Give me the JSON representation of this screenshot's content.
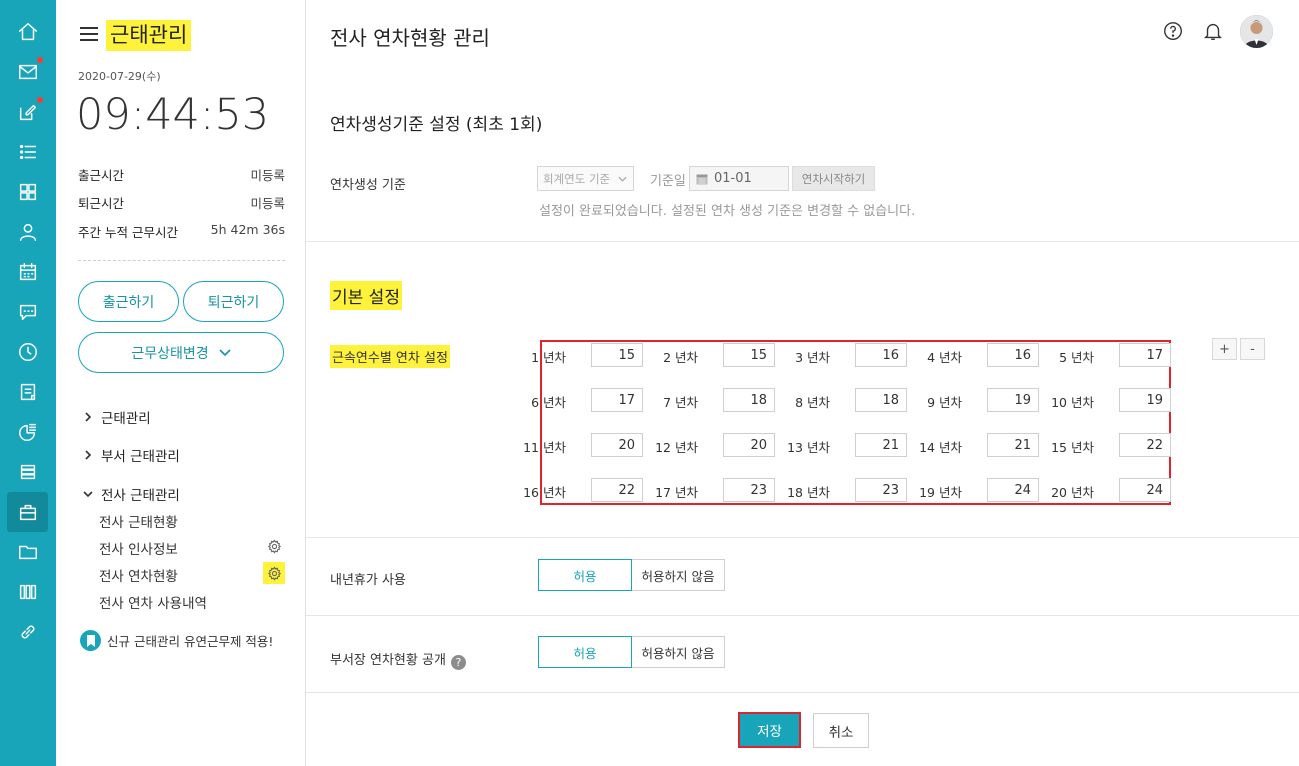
{
  "sidebar": {
    "app_title": "근태관리",
    "date": "2020-07-29(수)",
    "clock": "09:44:53",
    "stats": [
      {
        "label": "출근시간",
        "value": "미등록"
      },
      {
        "label": "퇴근시간",
        "value": "미등록"
      },
      {
        "label": "주간 누적 근무시간",
        "value": "5h 42m 36s"
      }
    ],
    "clock_in_label": "출근하기",
    "clock_out_label": "퇴근하기",
    "status_change_label": "근무상태변경",
    "nav": [
      {
        "label": "근태관리",
        "expanded": false
      },
      {
        "label": "부서 근태관리",
        "expanded": false
      },
      {
        "label": "전사 근태관리",
        "expanded": true
      }
    ],
    "sub_nav": [
      "전사 근태현황",
      "전사 인사정보",
      "전사 연차현황",
      "전사 연차 사용내역"
    ],
    "notice": "신규 근태관리 유연근무제 적용!"
  },
  "header": {
    "title": "전사 연차현황 관리"
  },
  "section_criteria": {
    "title": "연차생성기준 설정 (최초 1회)",
    "label": "연차생성 기준",
    "select_value": "회계연도 기준",
    "ref_label": "기준일",
    "ref_date": "01-01",
    "start_button": "연차시작하기",
    "hint": "설정이 완료되었습니다. 설정된 연차 생성 기준은 변경할 수 없습니다."
  },
  "section_basic": {
    "title": "기본 설정",
    "years_label": "근속연수별 연차 설정",
    "add_label": "+",
    "remove_label": "-",
    "year_entries": [
      {
        "label": "1 년차",
        "value": "15"
      },
      {
        "label": "2 년차",
        "value": "15"
      },
      {
        "label": "3 년차",
        "value": "16"
      },
      {
        "label": "4 년차",
        "value": "16"
      },
      {
        "label": "5 년차",
        "value": "17"
      },
      {
        "label": "6 년차",
        "value": "17"
      },
      {
        "label": "7 년차",
        "value": "18"
      },
      {
        "label": "8 년차",
        "value": "18"
      },
      {
        "label": "9 년차",
        "value": "19"
      },
      {
        "label": "10 년차",
        "value": "19"
      },
      {
        "label": "11 년차",
        "value": "20"
      },
      {
        "label": "12 년차",
        "value": "20"
      },
      {
        "label": "13 년차",
        "value": "21"
      },
      {
        "label": "14 년차",
        "value": "21"
      },
      {
        "label": "15 년차",
        "value": "22"
      },
      {
        "label": "16 년차",
        "value": "22"
      },
      {
        "label": "17 년차",
        "value": "23"
      },
      {
        "label": "18 년차",
        "value": "23"
      },
      {
        "label": "19 년차",
        "value": "24"
      },
      {
        "label": "20 년차",
        "value": "24"
      }
    ],
    "next_year_label": "내년휴가 사용",
    "next_year_allow": "허용",
    "next_year_deny": "허용하지 않음",
    "dept_label": "부서장 연차현황 공개",
    "dept_help": "?",
    "dept_allow": "허용",
    "dept_deny": "허용하지 않음"
  },
  "footer": {
    "save_label": "저장",
    "cancel_label": "취소"
  },
  "colors": {
    "accent": "#18a5b9",
    "highlight": "#fff23a",
    "red_outline": "#e0242d"
  }
}
